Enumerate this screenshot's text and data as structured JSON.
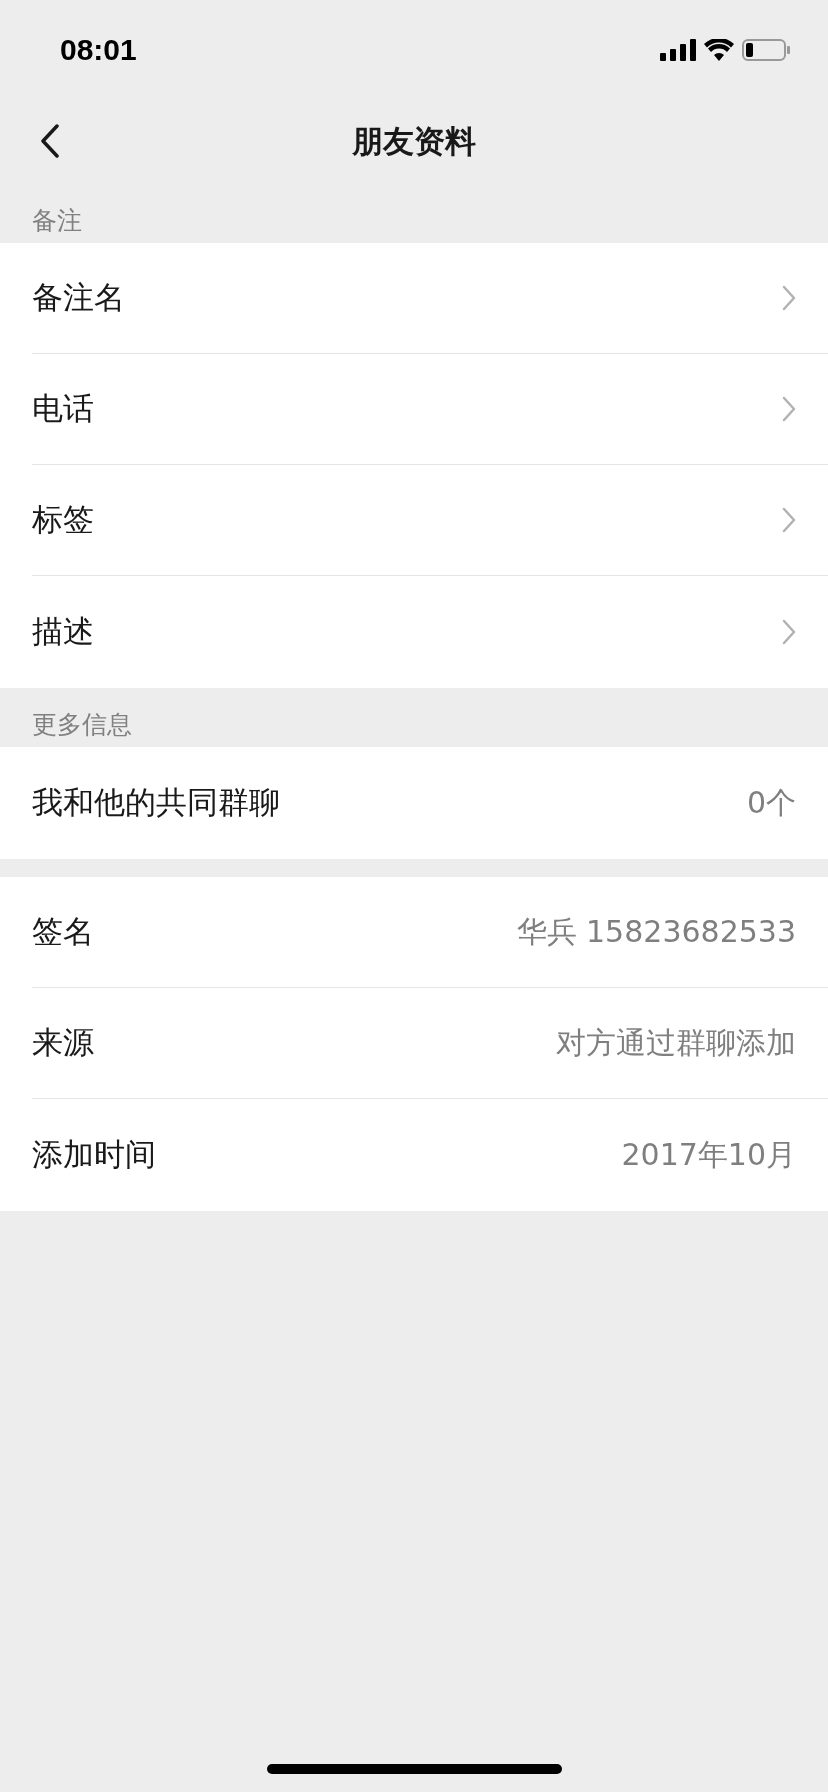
{
  "status_bar": {
    "time": "08:01"
  },
  "nav": {
    "title": "朋友资料"
  },
  "sections": [
    {
      "header": "备注",
      "rows": [
        {
          "label": "备注名",
          "chevron": true
        },
        {
          "label": "电话",
          "chevron": true
        },
        {
          "label": "标签",
          "chevron": true
        },
        {
          "label": "描述",
          "chevron": true
        }
      ]
    },
    {
      "header": "更多信息",
      "rows": [
        {
          "label": "我和他的共同群聊",
          "value": "0个",
          "chevron": false
        }
      ]
    },
    {
      "rows": [
        {
          "label": "签名",
          "value": "华兵 15823682533",
          "chevron": false
        },
        {
          "label": "来源",
          "value": "对方通过群聊添加",
          "chevron": false
        },
        {
          "label": "添加时间",
          "value": "2017年10月",
          "chevron": false
        }
      ]
    }
  ]
}
